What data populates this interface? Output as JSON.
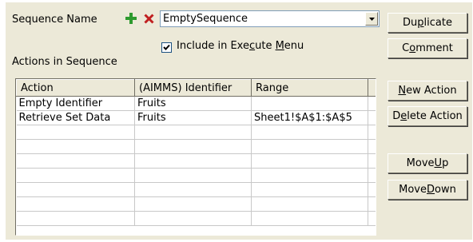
{
  "sequence": {
    "name_label": "Sequence Name",
    "add_icon": "plus-icon",
    "delete_icon": "x-icon",
    "selected": "EmptySequence"
  },
  "include": {
    "checked": true,
    "label_before": "Include in Exe",
    "label_accel": "c",
    "label_mid": "ute ",
    "label_accel2": "M",
    "label_after": "enu"
  },
  "actions_label": "Actions in Sequence",
  "table": {
    "columns": [
      "Action",
      "(AIMMS) Identifier",
      "Range"
    ],
    "rows": [
      [
        "Empty Identifier",
        "Fruits",
        ""
      ],
      [
        "Retrieve Set Data",
        "Fruits",
        "Sheet1!$A$1:$A$5"
      ]
    ]
  },
  "buttons": {
    "duplicate": {
      "pre": "Du",
      "acc": "p",
      "post": "licate"
    },
    "comment": {
      "pre": "C",
      "acc": "o",
      "post": "mment"
    },
    "new_action": {
      "pre": "",
      "acc": "N",
      "post": "ew Action"
    },
    "delete_action": {
      "pre": "D",
      "acc": "e",
      "post": "lete Action"
    },
    "move_up": {
      "pre": "Move ",
      "acc": "U",
      "post": "p"
    },
    "move_down": {
      "pre": "Move ",
      "acc": "D",
      "post": "own"
    }
  }
}
